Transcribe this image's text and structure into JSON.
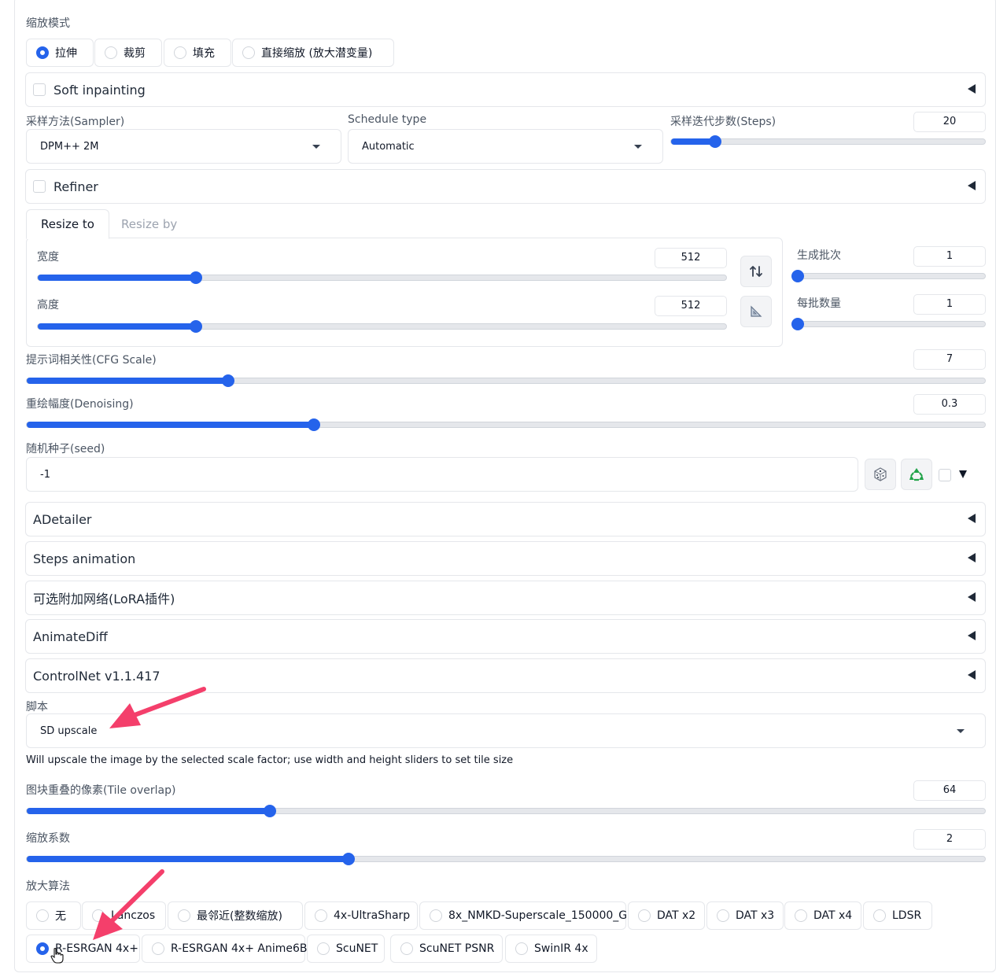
{
  "resize_mode": {
    "label": "缩放模式",
    "options": [
      {
        "label": "拉伸",
        "selected": true
      },
      {
        "label": "裁剪",
        "selected": false
      },
      {
        "label": "填充",
        "selected": false
      },
      {
        "label": "直接缩放 (放大潜变量)",
        "selected": false
      }
    ]
  },
  "soft_inpainting": {
    "label": "Soft inpainting",
    "checked": false
  },
  "sampler": {
    "label": "采样方法(Sampler)",
    "value": "DPM++ 2M"
  },
  "schedule": {
    "label": "Schedule type",
    "value": "Automatic"
  },
  "steps": {
    "label": "采样迭代步数(Steps)",
    "value": "20",
    "fraction": 0.14
  },
  "refiner": {
    "label": "Refiner",
    "checked": false
  },
  "tabs": [
    {
      "label": "Resize to",
      "active": true
    },
    {
      "label": "Resize by",
      "active": false
    }
  ],
  "width": {
    "label": "宽度",
    "value": "512",
    "fraction": 0.23
  },
  "height": {
    "label": "高度",
    "value": "512",
    "fraction": 0.23
  },
  "batch_count": {
    "label": "生成批次",
    "value": "1",
    "fraction": 0.0
  },
  "batch_size": {
    "label": "每批数量",
    "value": "1",
    "fraction": 0.0
  },
  "cfg": {
    "label": "提示词相关性(CFG Scale)",
    "value": "7",
    "fraction": 0.21
  },
  "denoising": {
    "label": "重绘幅度(Denoising)",
    "value": "0.3",
    "fraction": 0.3
  },
  "seed": {
    "label": "随机种子(seed)",
    "value": "-1"
  },
  "accordions": [
    {
      "label": "ADetailer"
    },
    {
      "label": "Steps animation"
    },
    {
      "label": "可选附加网络(LoRA插件)"
    },
    {
      "label": "AnimateDiff"
    },
    {
      "label": "ControlNet v1.1.417"
    }
  ],
  "script": {
    "label": "脚本",
    "value": "SD upscale",
    "info": "Will upscale the image by the selected scale factor; use width and height sliders to set tile size"
  },
  "tile_overlap": {
    "label": "图块重叠的像素(Tile overlap)",
    "value": "64",
    "fraction": 0.254
  },
  "scale_factor": {
    "label": "缩放系数",
    "value": "2",
    "fraction": 0.336
  },
  "upscaler": {
    "label": "放大算法",
    "row1": [
      {
        "label": "无",
        "selected": false
      },
      {
        "label": "Lanczos",
        "selected": false
      },
      {
        "label": "最邻近(整数缩放)",
        "selected": false
      },
      {
        "label": "4x-UltraSharp",
        "selected": false
      },
      {
        "label": "8x_NMKD-Superscale_150000_G",
        "selected": false
      },
      {
        "label": "DAT x2",
        "selected": false
      },
      {
        "label": "DAT x3",
        "selected": false
      },
      {
        "label": "DAT x4",
        "selected": false
      },
      {
        "label": "LDSR",
        "selected": false
      }
    ],
    "row2": [
      {
        "label": "R-ESRGAN 4x+",
        "selected": true
      },
      {
        "label": "R-ESRGAN 4x+ Anime6B",
        "selected": false
      },
      {
        "label": "ScuNET",
        "selected": false
      },
      {
        "label": "ScuNET PSNR",
        "selected": false
      },
      {
        "label": "SwinIR 4x",
        "selected": false
      }
    ]
  },
  "colors": {
    "accent": "#2563eb",
    "annotation": "#f43f6b"
  },
  "icons": {
    "swap": "swap-arrows-icon",
    "ratio": "triangle-ruler-icon",
    "dice": "dice-icon",
    "recycle": "recycle-icon"
  }
}
